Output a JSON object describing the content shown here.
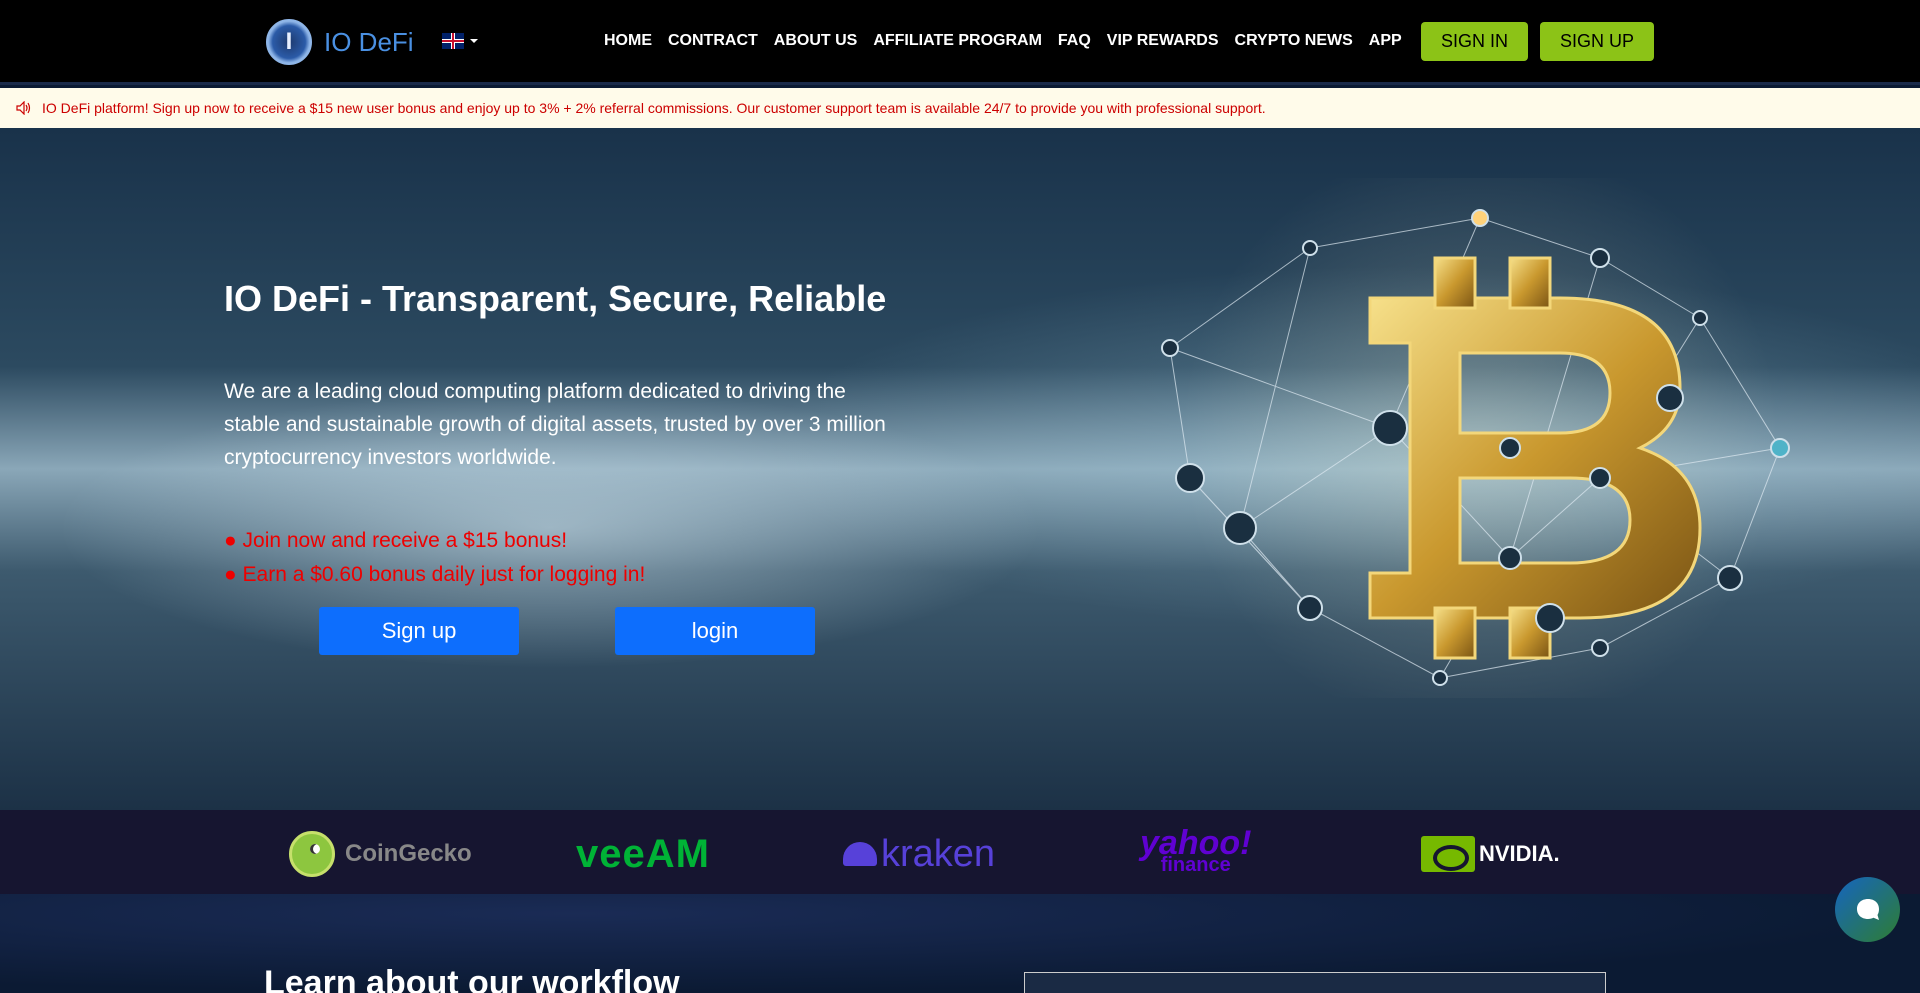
{
  "header": {
    "brand": "IO DeFi",
    "logo_letter": "I",
    "nav": [
      "HOME",
      "CONTRACT",
      "ABOUT US",
      "AFFILIATE PROGRAM",
      "FAQ",
      "VIP REWARDS",
      "CRYPTO NEWS",
      "APP"
    ],
    "sign_in": "SIGN IN",
    "sign_up": "SIGN UP",
    "colors": {
      "accent": "#8cc317",
      "brand": "#4a90e2"
    }
  },
  "notice": {
    "text": "IO DeFi platform! Sign up now to receive a $15 new user bonus and enjoy up to 3% + 2% referral commissions. Our customer support team is available 24/7 to provide you with professional support."
  },
  "hero": {
    "title": "IO DeFi - Transparent, Secure, Reliable",
    "description": "We are a leading cloud computing platform dedicated to driving the stable and sustainable growth of digital assets, trusted by over 3 million cryptocurrency investors worldwide.",
    "bullets": [
      "● Join now and receive a $15 bonus!",
      "● Earn a $0.60 bonus daily just for logging in!"
    ],
    "signup_button": "Sign up",
    "login_button": "login"
  },
  "partners": {
    "coingecko": "CoinGecko",
    "veeam": "veeAM",
    "kraken": "kraken",
    "yahoo_line1": "yahoo!",
    "yahoo_line2": "finance",
    "nvidia": "NVIDIA."
  },
  "section": {
    "workflow_title": "Learn about our workflow"
  }
}
